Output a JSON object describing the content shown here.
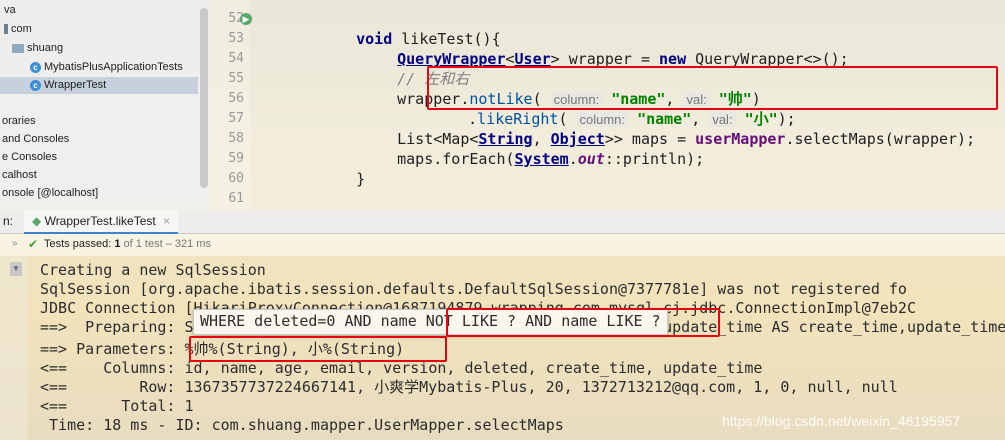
{
  "project_tree": {
    "items": [
      {
        "label": "va"
      },
      {
        "label": "com"
      },
      {
        "label": "shuang"
      },
      {
        "label": "MybatisPlusApplicationTests"
      },
      {
        "label": "WrapperTest"
      },
      {
        "label": "oraries"
      },
      {
        "label": "and Consoles"
      },
      {
        "label": "e Consoles"
      },
      {
        "label": "calhost"
      },
      {
        "label": "onsole [@localhost]"
      }
    ]
  },
  "editor": {
    "line_numbers": [
      "52",
      "53",
      "54",
      "55",
      "56",
      "57",
      "58",
      "59",
      "60",
      "61"
    ],
    "code": {
      "l52_kw": "void",
      "l52_rest": " likeTest(){",
      "l53_type": "QueryWrapper",
      "l53_lt": "<",
      "l53_user": "User",
      "l53_mid": "> wrapper = ",
      "l53_new": "new",
      "l53_rest": " QueryWrapper<>();",
      "l54_comment": "// 左和右",
      "l55_pre": "wrapper.",
      "l55_method": "notLike",
      "l55_open": "( ",
      "l55_hint1": "column:",
      "l55_str1": "\"name\"",
      "l55_comma": ", ",
      "l55_hint2": "val:",
      "l55_str2": "\"帅\"",
      "l55_close": ")",
      "l56_dot": ".",
      "l56_method": "likeRight",
      "l56_open": "( ",
      "l56_hint1": "column:",
      "l56_str1": "\"name\"",
      "l56_comma": ", ",
      "l56_hint2": "val:",
      "l56_str2": "\"小\"",
      "l56_close": ");",
      "l57_pre": "List<Map<",
      "l57_string": "String",
      "l57_comma": ", ",
      "l57_object": "Object",
      "l57_mid": ">> maps = ",
      "l57_mapper": "userMapper",
      "l57_rest": ".selectMaps(wrapper);",
      "l58_pre": "maps.forEach(",
      "l58_system": "System",
      "l58_dot": ".",
      "l58_out": "out",
      "l58_rest": "::println);",
      "l59": "}"
    }
  },
  "run_panel": {
    "label": "n:",
    "tab_label": "WrapperTest.likeTest",
    "tab_close": "×"
  },
  "status_bar": {
    "passed": "Tests passed:",
    "count": "1",
    "of_total": "of 1 test",
    "duration": "– 321 ms"
  },
  "console": {
    "lines": [
      "Creating a new SqlSession",
      "SqlSession [org.apache.ibatis.session.defaults.DefaultSqlSession@7377781e] was not registered fo",
      "JDBC Connection [HikariProxyConnection@1687194879 wrapping com.mysql.cj.jdbc.ConnectionImpl@7eb2C",
      "==>  Preparing: SELECT id,name,age,email,version,deleted,create_time,update_time AS create_time,update_time",
      "==> Parameters: %帅%(String), 小%(String)",
      "<==    Columns: id, name, age, email, version, deleted, create_time, update_time",
      "<==        Row: 1367357737224667141, 小爽学Mybatis-Plus, 20, 1372713212@qq.com, 1, 0, null, null",
      "<==      Total: 1",
      " Time: 18 ms - ID: com.shuang.mapper.UserMapper.selectMaps"
    ],
    "sql_popup": "WHERE deleted=0 AND name NOT LIKE ? AND name LIKE ?"
  },
  "watermark": "https://blog.csdn.net/weixin_46195957",
  "colors": {
    "annotation_red": "#e60012",
    "keyword": "#000080",
    "string": "#008000",
    "tests_passed_green": "#4a9c3c"
  }
}
